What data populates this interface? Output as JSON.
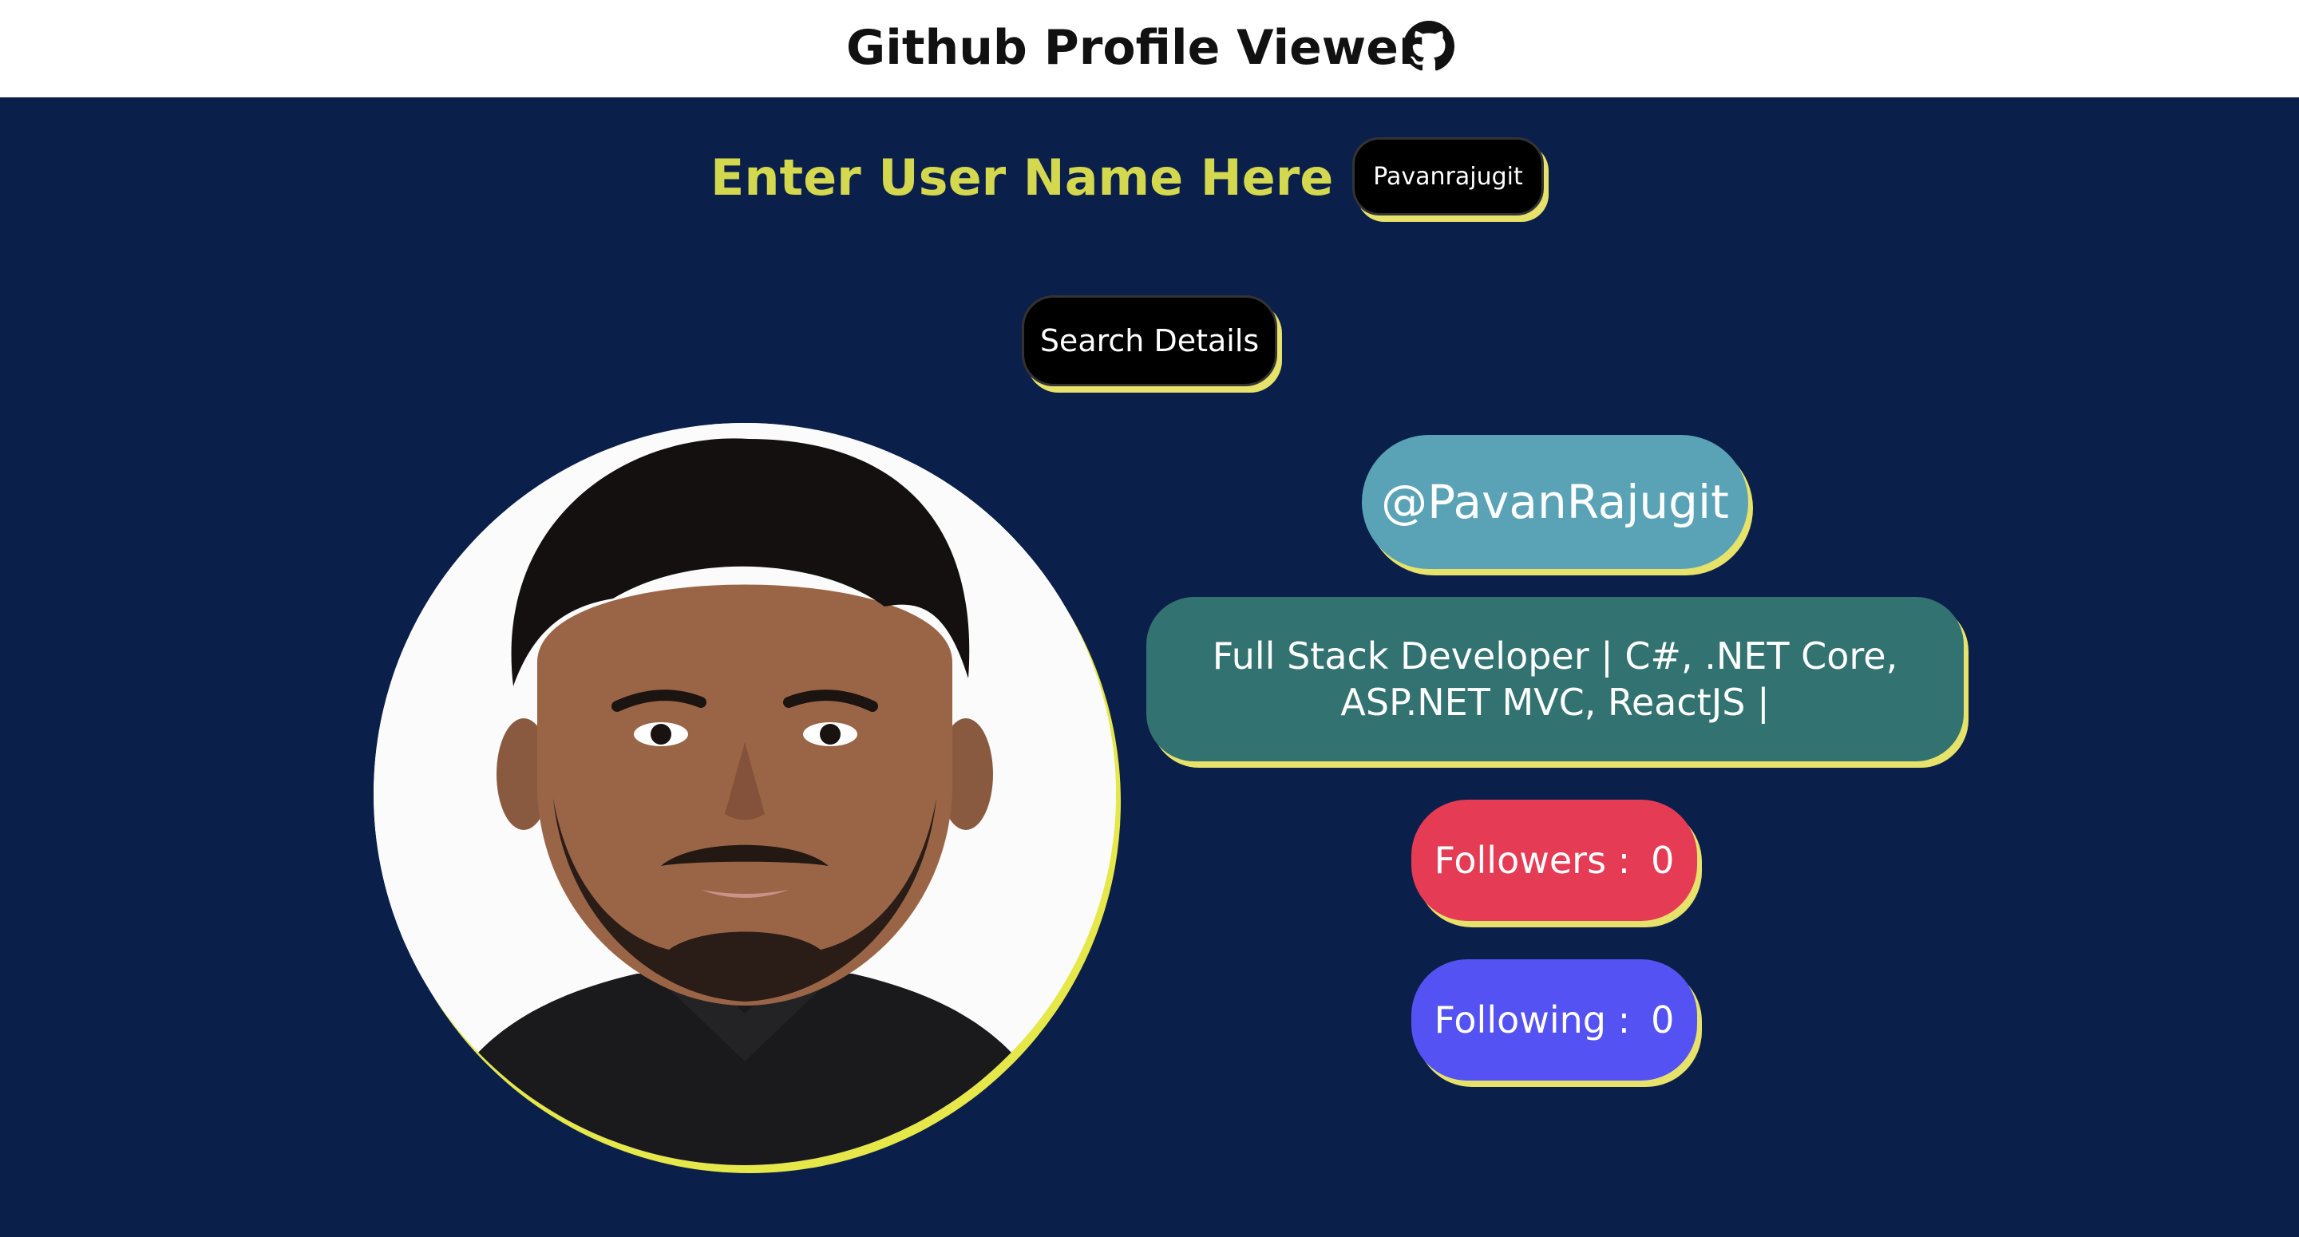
{
  "header": {
    "title": "Github Profile Viewer",
    "icon": "github-icon"
  },
  "search": {
    "prompt_label": "Enter User Name Here - >",
    "input_value": "Pavanrajugit",
    "button_label": "Search Details"
  },
  "profile": {
    "avatar_icon": "avatar",
    "login": "@PavanRajugit",
    "bio": "Full Stack Developer | C#, .NET Core, ASP.NET MVC, ReactJS |",
    "followers_label": "Followers :",
    "followers_count": "0",
    "following_label": "Following :",
    "following_count": "0"
  },
  "colors": {
    "background": "#0b1f4b",
    "header_background": "#ffffff",
    "accent_yellow": "#d4d84e",
    "login_pill": "#5aa3b6",
    "bio_pill": "#327270",
    "followers_pill": "#e63b54",
    "following_pill": "#5452f2"
  }
}
